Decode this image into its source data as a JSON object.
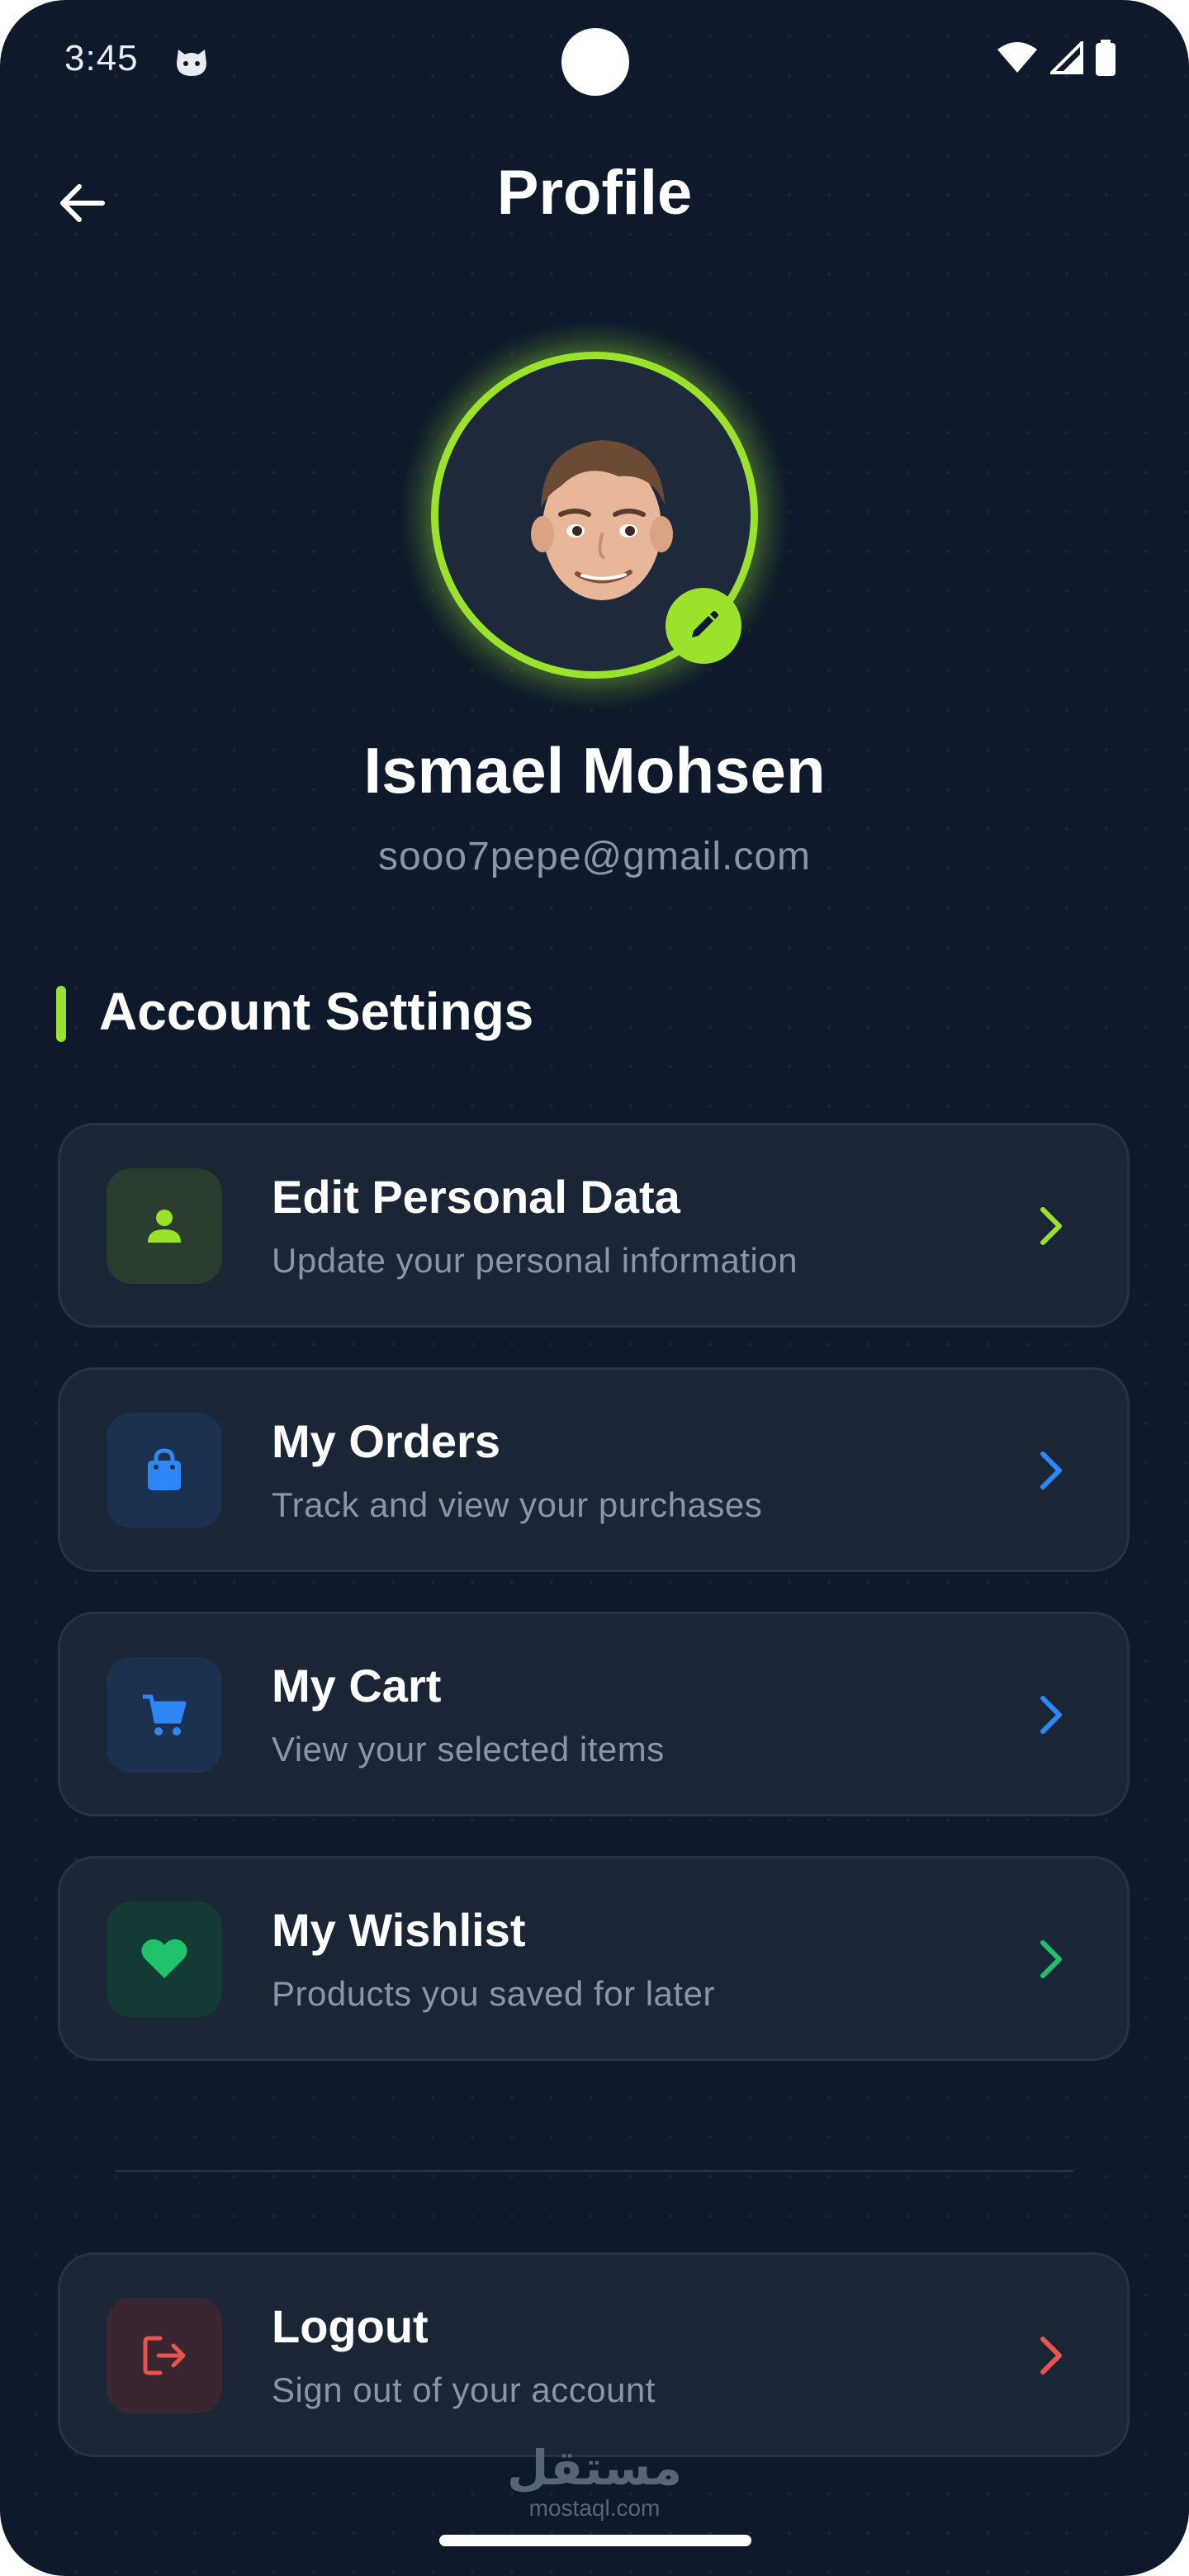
{
  "status_bar": {
    "time": "3:45"
  },
  "header": {
    "title": "Profile"
  },
  "profile": {
    "name": "Ismael Mohsen",
    "email": "sooo7pepe@gmail.com"
  },
  "section": {
    "title": "Account Settings"
  },
  "menu": [
    {
      "title": "Edit Personal Data",
      "subtitle": "Update your personal information",
      "icon": "person-icon",
      "accent": "#9be22d",
      "icon_bg": "#2b3d2f"
    },
    {
      "title": "My Orders",
      "subtitle": "Track and view your purchases",
      "icon": "shopping-bag-icon",
      "accent": "#2f86f6",
      "icon_bg": "#1c3150"
    },
    {
      "title": "My Cart",
      "subtitle": "View your selected items",
      "icon": "cart-icon",
      "accent": "#2f86f6",
      "icon_bg": "#1c3150"
    },
    {
      "title": "My Wishlist",
      "subtitle": "Products you saved for later",
      "icon": "heart-icon",
      "accent": "#1fc16b",
      "icon_bg": "#143a35"
    }
  ],
  "logout": {
    "title": "Logout",
    "subtitle": "Sign out of your account",
    "icon": "logout-icon",
    "accent": "#e8554e",
    "icon_bg": "#3a2630"
  },
  "watermark": {
    "arabic": "مستقل",
    "latin": "mostaql.com"
  },
  "colors": {
    "background": "#0e1a2b",
    "card": "#1a2536",
    "accent_green": "#9be22d",
    "muted_text": "#8a96a8"
  }
}
